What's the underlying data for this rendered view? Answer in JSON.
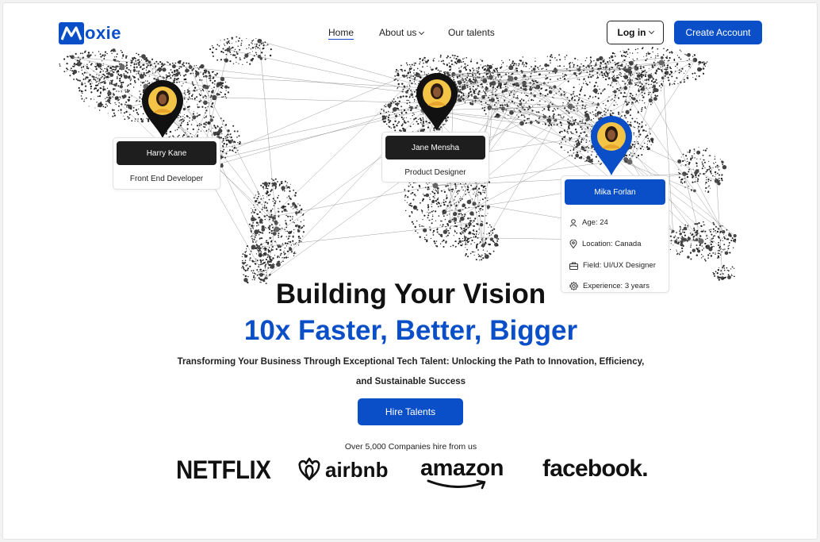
{
  "brand": {
    "name": "oxie",
    "accent": "#0a4fc7"
  },
  "nav": {
    "home": "Home",
    "about": "About us",
    "talents": "Our talents",
    "login": "Log in",
    "create_account": "Create Account"
  },
  "talents": [
    {
      "name": "Harry Kane",
      "role": "Front End Developer"
    },
    {
      "name": "Jane Mensha",
      "role": "Product Designer"
    },
    {
      "name": "Mika Forlan",
      "age_label": "Age:",
      "age": "24",
      "location_label": "Location:",
      "location": "Canada",
      "field_label": "Field:",
      "field": "UI/UX Designer",
      "experience_label": "Experience:",
      "experience": "3 years"
    }
  ],
  "hero": {
    "title": "Building Your Vision",
    "tagline": "10x Faster, Better, Bigger",
    "description_line1": "Transforming Your Business Through Exceptional Tech Talent: Unlocking the Path to Innovation, Efficiency,",
    "description_line2": "and Sustainable Success",
    "cta": "Hire Talents"
  },
  "companies": {
    "heading": "Over 5,000 Companies hire from us",
    "logos": [
      "NETFLIX",
      "airbnb",
      "amazon",
      "facebook."
    ]
  },
  "icons": [
    "user-icon",
    "location-pin-icon",
    "briefcase-icon",
    "settings-icon",
    "chevron-down-icon",
    "map-pin-icon"
  ]
}
